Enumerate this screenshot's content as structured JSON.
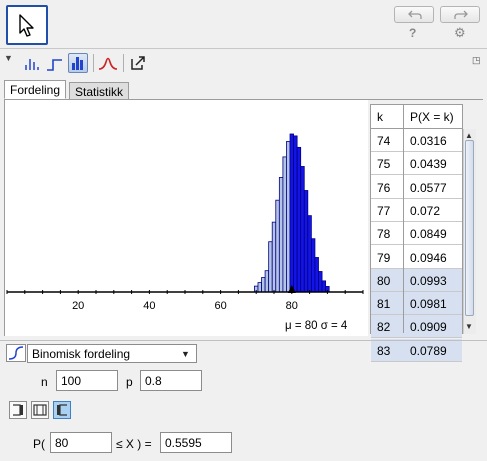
{
  "tabs": [
    {
      "label": "Fordeling"
    },
    {
      "label": "Statistikk"
    }
  ],
  "chart_data": {
    "type": "bar",
    "x_ticks": [
      20,
      40,
      60,
      80
    ],
    "xlim": [
      0,
      100
    ],
    "bars": [
      {
        "k": 70,
        "p": 0.0037
      },
      {
        "k": 71,
        "p": 0.0059
      },
      {
        "k": 72,
        "p": 0.0091
      },
      {
        "k": 73,
        "p": 0.0134
      },
      {
        "k": 74,
        "p": 0.0316
      },
      {
        "k": 75,
        "p": 0.0439
      },
      {
        "k": 76,
        "p": 0.0577
      },
      {
        "k": 77,
        "p": 0.072
      },
      {
        "k": 78,
        "p": 0.0849
      },
      {
        "k": 79,
        "p": 0.0946
      },
      {
        "k": 80,
        "p": 0.0993
      },
      {
        "k": 81,
        "p": 0.0981
      },
      {
        "k": 82,
        "p": 0.0909
      },
      {
        "k": 83,
        "p": 0.0789
      },
      {
        "k": 84,
        "p": 0.0638
      },
      {
        "k": 85,
        "p": 0.048
      },
      {
        "k": 86,
        "p": 0.0335
      },
      {
        "k": 87,
        "p": 0.0217
      },
      {
        "k": 88,
        "p": 0.0129
      },
      {
        "k": 89,
        "p": 0.007
      },
      {
        "k": 90,
        "p": 0.0035
      }
    ],
    "shaded_from": 80,
    "colors": {
      "shaded": "#1414e6",
      "unshaded": "#b4c4e6",
      "outline": "#000080"
    },
    "stats_text": "μ = 80    σ = 4",
    "marker_value": 80
  },
  "table": {
    "headers": [
      "k",
      "P(X = k)"
    ],
    "rows": [
      {
        "k": "74",
        "p": "0.0316",
        "hl": false
      },
      {
        "k": "75",
        "p": "0.0439",
        "hl": false
      },
      {
        "k": "76",
        "p": "0.0577",
        "hl": false
      },
      {
        "k": "77",
        "p": "0.072",
        "hl": false
      },
      {
        "k": "78",
        "p": "0.0849",
        "hl": false
      },
      {
        "k": "79",
        "p": "0.0946",
        "hl": false
      },
      {
        "k": "80",
        "p": "0.0993",
        "hl": true
      },
      {
        "k": "81",
        "p": "0.0981",
        "hl": true
      },
      {
        "k": "82",
        "p": "0.0909",
        "hl": true
      },
      {
        "k": "83",
        "p": "0.0789",
        "hl": true
      }
    ]
  },
  "controls": {
    "distribution": "Binomisk fordeling",
    "n_label": "n",
    "n_value": "100",
    "p_label": "p",
    "p_value": "0.8",
    "prob_prefix": "P(",
    "prob_lower": "80",
    "prob_op": "≤ X ) =",
    "prob_result": "0.5595"
  },
  "toolbar": {
    "help": "?",
    "gear": "⚙"
  }
}
